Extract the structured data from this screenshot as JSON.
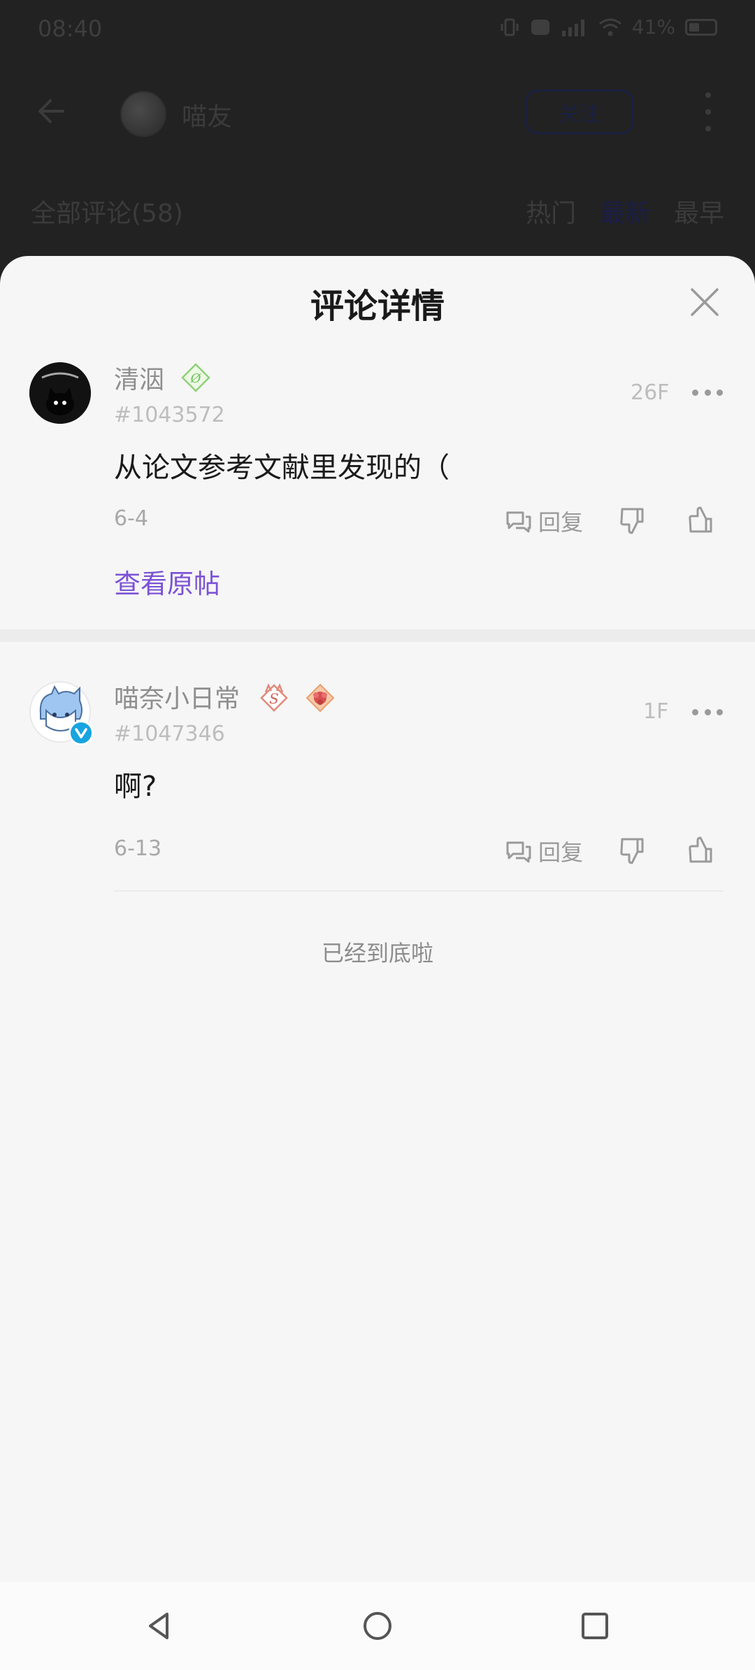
{
  "status_bar": {
    "time": "08:40",
    "battery": "41%"
  },
  "background_page": {
    "title": "喵友",
    "follow_label": "关注",
    "comments_header": "全部评论(58)",
    "sort_tabs": [
      "热门",
      "最新",
      "最早"
    ],
    "active_sort": "最新"
  },
  "sheet": {
    "title": "评论详情",
    "comments": [
      {
        "username": "清洇",
        "user_id": "#1043572",
        "floor": "26F",
        "content": "从论文参考文献里发现的（",
        "date": "6-4",
        "reply_label": "回复",
        "view_original": "查看原帖"
      },
      {
        "username": "喵奈小日常",
        "user_id": "#1047346",
        "floor": "1F",
        "content": "啊?",
        "date": "6-13",
        "reply_label": "回复"
      }
    ],
    "end_text": "已经到底啦"
  },
  "colors": {
    "accent": "#7c52d6",
    "verify": "#18a4e0",
    "sheet_bg": "#f6f6f6"
  }
}
